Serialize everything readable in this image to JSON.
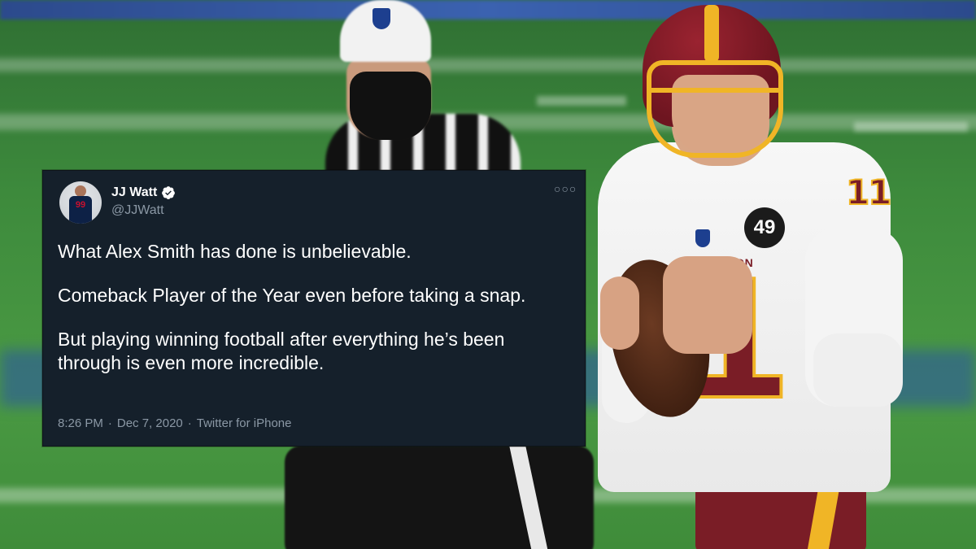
{
  "tweet": {
    "display_name": "JJ Watt",
    "handle": "@JJWatt",
    "more_icon": "more-horizontal-icon",
    "paragraphs": [
      "What Alex Smith has done is unbelievable.",
      "Comeback Player of the Year even before taking a snap.",
      "But playing winning football after everything he’s been through is even more incredible."
    ],
    "time": "8:26 PM",
    "separator": "·",
    "date": "Dec 7, 2020",
    "source": "Twitter for iPhone",
    "avatar_jersey_number": "99",
    "colors": {
      "background": "#15202b",
      "text": "#ffffff",
      "secondary": "#8b98a5",
      "verified": "#ffffff"
    }
  },
  "photo": {
    "shoulder_number": "11",
    "patch_number": "49",
    "wordmark": "ASHINGTON",
    "chest_number": "1",
    "colors": {
      "field": "#3f8a3a",
      "burgundy": "#7a1d26",
      "gold": "#f0b526"
    }
  }
}
